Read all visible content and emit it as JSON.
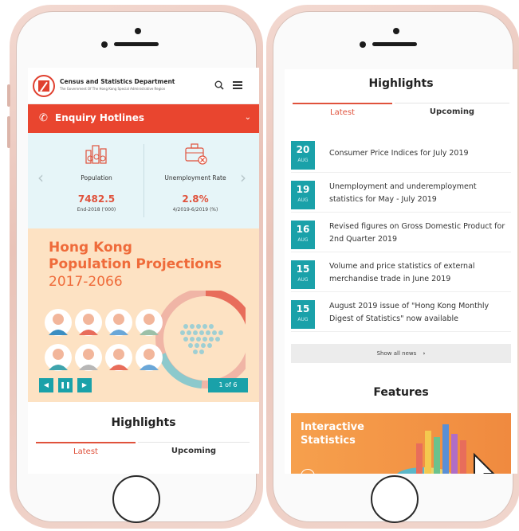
{
  "left": {
    "header": {
      "title": "Census and Statistics Department",
      "subtitle": "The Government Of The Hong Kong Special Administrative Region"
    },
    "enquiry": {
      "label": "Enquiry Hotlines"
    },
    "stats": [
      {
        "label": "Population",
        "value": "7482.5",
        "sub": "End-2018 ('000)"
      },
      {
        "label": "Unemployment Rate",
        "value": "2.8%",
        "sub": "4/2019-6/2019 (%)"
      }
    ],
    "banner": {
      "line1": "Hong Kong",
      "line2": "Population Projections",
      "line3": "2017-2066",
      "counter": "1 of 6"
    },
    "highlights": {
      "title": "Highlights",
      "tabs": [
        "Latest",
        "Upcoming"
      ]
    }
  },
  "right": {
    "highlights": {
      "title": "Highlights",
      "tabs": [
        "Latest",
        "Upcoming"
      ]
    },
    "news": [
      {
        "day": "20",
        "month": "AUG",
        "text": "Consumer Price Indices for July 2019"
      },
      {
        "day": "19",
        "month": "AUG",
        "text": "Unemployment and underemployment statistics for May - July 2019"
      },
      {
        "day": "16",
        "month": "AUG",
        "text": "Revised figures on Gross Domestic Product for 2nd Quarter 2019"
      },
      {
        "day": "15",
        "month": "AUG",
        "text": "Volume and price statistics of external merchandise trade in June 2019"
      },
      {
        "day": "15",
        "month": "AUG",
        "text": "August 2019 issue of \"Hong Kong Monthly Digest of Statistics\" now available"
      }
    ],
    "show_all": "Show all news",
    "features": {
      "title": "Features",
      "banner_line1": "Interactive",
      "banner_line2": "Statistics"
    }
  },
  "colors": {
    "accent_red": "#e9452f",
    "accent_teal": "#1aa1a9",
    "banner_orange": "#ef6b3a"
  }
}
